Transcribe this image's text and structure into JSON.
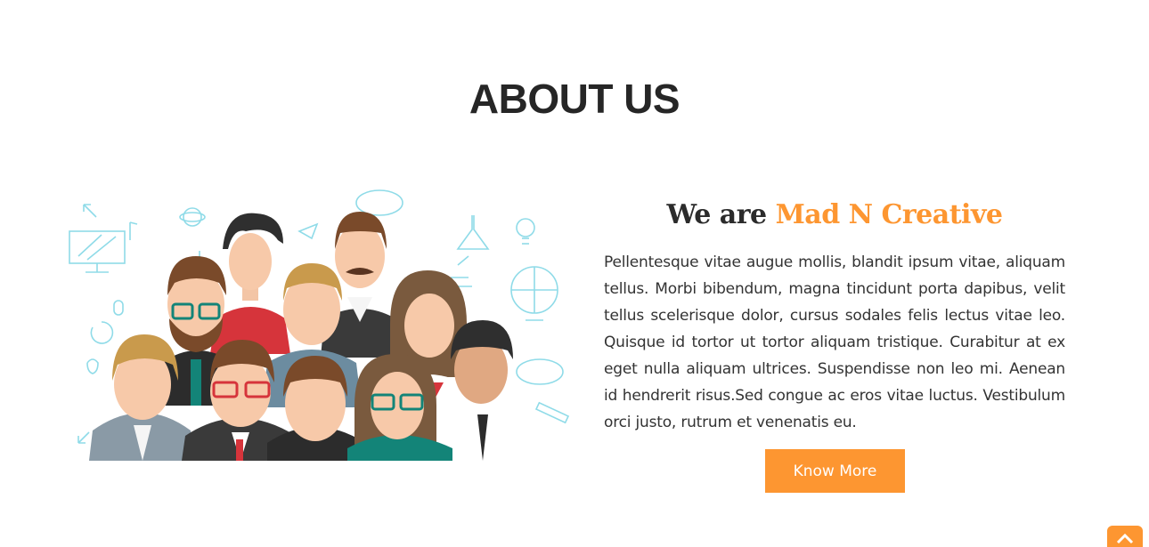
{
  "section": {
    "title": "ABOUT US"
  },
  "about": {
    "tagline_prefix": "We are ",
    "tagline_accent": "Mad N Creative",
    "description": "Pellentesque vitae augue mollis, blandit ipsum vitae, aliquam tellus. Morbi bibendum, magna tincidunt porta dapibus, velit tellus scelerisque dolor, cursus sodales felis lectus vitae leo. Quisque id tortor ut tortor aliquam tristique. Curabitur at ex eget nulla aliquam ultrices. Suspendisse non leo mi. Aenean id hendrerit risus.Sed congue ac eros vitae luctus. Vestibulum orci justo, rutrum et venenatis eu.",
    "cta_label": "Know More"
  },
  "colors": {
    "accent": "#fd9631",
    "heading": "#262626",
    "doodle": "#8fdbe8"
  },
  "icons": {
    "back_to_top": "chevron-up-icon"
  }
}
